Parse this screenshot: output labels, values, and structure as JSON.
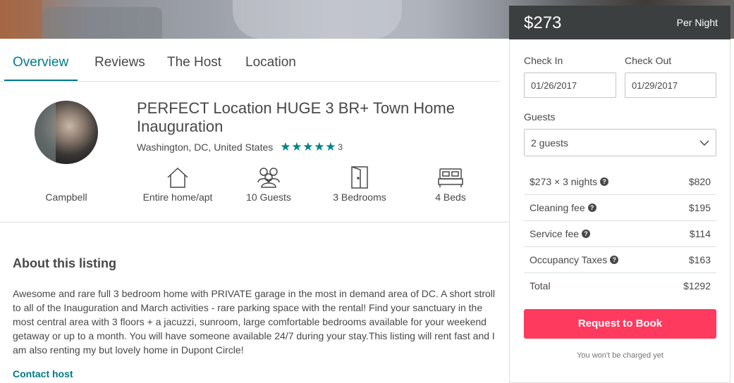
{
  "tabs": {
    "overview": "Overview",
    "reviews": "Reviews",
    "host": "The Host",
    "location": "Location"
  },
  "listing": {
    "title": "PERFECT Location HUGE 3 BR+ Town Home Inauguration",
    "location": "Washington, DC, United States",
    "rating_stars": 5,
    "review_count": "3",
    "host_name": "Campbell"
  },
  "amenities": [
    {
      "icon": "home-icon",
      "label": "Entire home/apt"
    },
    {
      "icon": "guests-icon",
      "label": "10 Guests"
    },
    {
      "icon": "door-icon",
      "label": "3 Bedrooms"
    },
    {
      "icon": "bed-icon",
      "label": "4 Beds"
    }
  ],
  "about": {
    "title": "About this listing",
    "text": "Awesome and rare full 3 bedroom home with PRIVATE garage in the most in demand area of DC. A short stroll to all of the Inauguration and March activities - rare parking space with the rental! Find your sanctuary in the most central area with 3 floors + a jacuzzi, sunroom, large comfortable bedrooms available for your weekend getaway or up to a month. You will have someone available 24/7 during your stay.This listing will rent fast and I am also renting my but lovely home in Dupont Circle!",
    "contact": "Contact host"
  },
  "booking": {
    "price": "$273",
    "per": "Per Night",
    "check_in_label": "Check In",
    "check_out_label": "Check Out",
    "check_in_value": "01/26/2017",
    "check_out_value": "01/29/2017",
    "guests_label": "Guests",
    "guests_value": "2 guests",
    "fees": [
      {
        "name": "$273 × 3 nights",
        "amount": "$820",
        "help": true
      },
      {
        "name": "Cleaning fee",
        "amount": "$195",
        "help": true
      },
      {
        "name": "Service fee",
        "amount": "$114",
        "help": true
      },
      {
        "name": "Occupancy Taxes",
        "amount": "$163",
        "help": true
      },
      {
        "name": "Total",
        "amount": "$1292",
        "help": false
      }
    ],
    "button": "Request to Book",
    "note": "You won't be charged yet"
  },
  "colors": {
    "accent": "#007a87",
    "star": "#008489",
    "book_button": "#ff3a5f",
    "price_bar": "#3c3f40"
  }
}
